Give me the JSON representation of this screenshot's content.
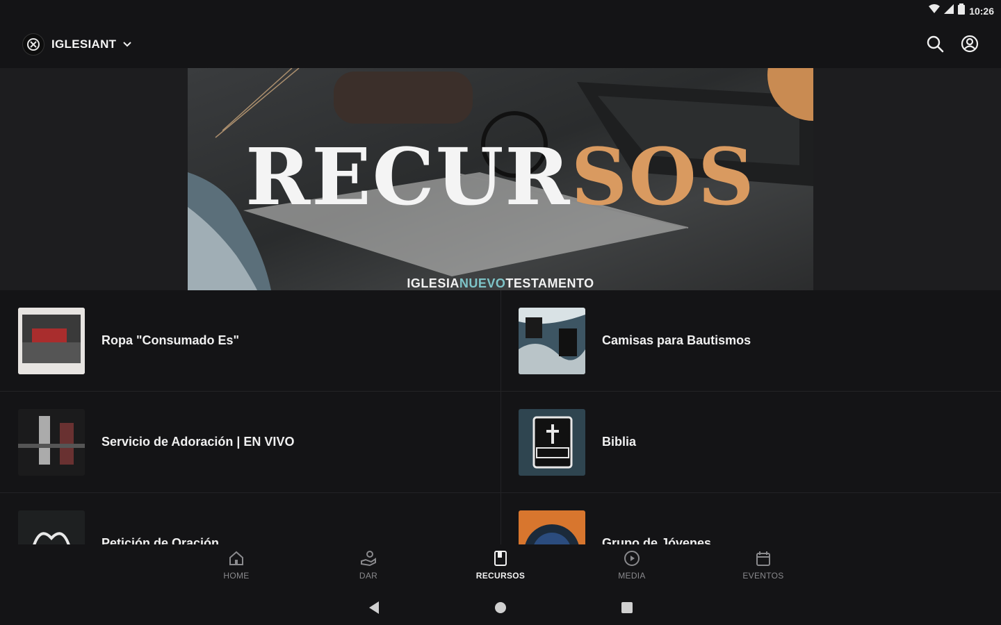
{
  "status_bar": {
    "time": "10:26"
  },
  "app_bar": {
    "brand": "IGLESIANT"
  },
  "banner": {
    "title_part1": "RECUR",
    "title_part2": "SOS",
    "subtitle_part1": "IGLESIA",
    "subtitle_part2": "NUEVO",
    "subtitle_part3": "TESTAMENTO"
  },
  "resources": [
    {
      "title": "Ropa \"Consumado Es\""
    },
    {
      "title": "Camisas para Bautismos"
    },
    {
      "title": "Servicio de Adoración | EN VIVO"
    },
    {
      "title": "Biblia"
    },
    {
      "title": "Petición de Oración"
    },
    {
      "title": "Grupo de Jóvenes"
    }
  ],
  "bottom_nav": [
    {
      "label": "HOME",
      "icon": "home-icon",
      "active": false
    },
    {
      "label": "DAR",
      "icon": "give-icon",
      "active": false
    },
    {
      "label": "RECURSOS",
      "icon": "book-icon",
      "active": true
    },
    {
      "label": "MEDIA",
      "icon": "play-icon",
      "active": false
    },
    {
      "label": "EVENTOS",
      "icon": "calendar-icon",
      "active": false
    }
  ],
  "colors": {
    "background": "#141416",
    "accent_orange": "#d99a60",
    "accent_teal": "#7ec4c8",
    "inactive": "#8a8a8d"
  }
}
